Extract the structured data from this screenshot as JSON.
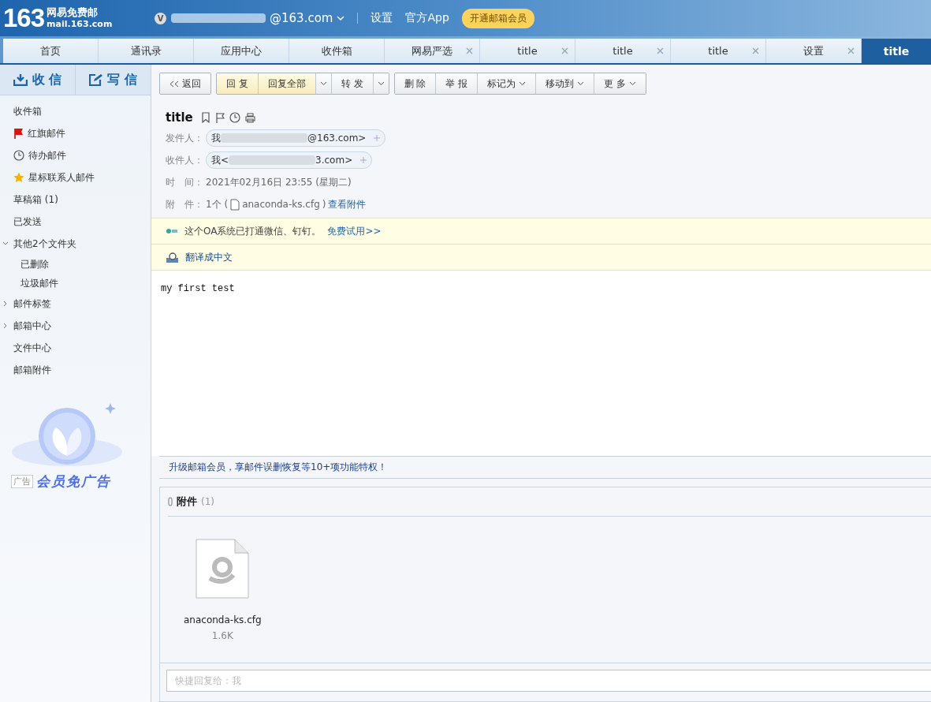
{
  "header": {
    "logo_number": "163",
    "logo_name": "网易免费邮",
    "logo_domain": "mail.163.com",
    "account_badge": "V",
    "account": "@163.com",
    "links": [
      "设置",
      "官方App"
    ],
    "vip_button": "开通邮箱会员"
  },
  "tabs": [
    {
      "label": "首页",
      "closable": false,
      "selected": false
    },
    {
      "label": "通讯录",
      "closable": false,
      "selected": false
    },
    {
      "label": "应用中心",
      "closable": false,
      "selected": false
    },
    {
      "label": "收件箱",
      "closable": false,
      "selected": false
    },
    {
      "label": "网易严选",
      "closable": true,
      "selected": false
    },
    {
      "label": "title",
      "closable": true,
      "selected": false
    },
    {
      "label": "title",
      "closable": true,
      "selected": false
    },
    {
      "label": "title",
      "closable": true,
      "selected": false
    },
    {
      "label": "设置",
      "closable": true,
      "selected": false
    },
    {
      "label": "title",
      "closable": false,
      "selected": true
    }
  ],
  "sidebar": {
    "receive": "收 信",
    "compose": "写 信",
    "items": [
      {
        "label": "收件箱",
        "kind": "plain"
      },
      {
        "label": "红旗邮件",
        "kind": "flag"
      },
      {
        "label": "待办邮件",
        "kind": "clock"
      },
      {
        "label": "星标联系人邮件",
        "kind": "star"
      },
      {
        "label": "草稿箱 (1)",
        "kind": "plain"
      },
      {
        "label": "已发送",
        "kind": "plain"
      },
      {
        "label": "其他2个文件夹",
        "kind": "folder",
        "expanded": true,
        "children": [
          {
            "label": "已删除"
          },
          {
            "label": "垃圾邮件"
          }
        ]
      },
      {
        "label": "邮件标签",
        "kind": "folder",
        "expanded": false
      },
      {
        "label": "邮箱中心",
        "kind": "folder",
        "expanded": false
      },
      {
        "label": "文件中心",
        "kind": "plain"
      },
      {
        "label": "邮箱附件",
        "kind": "plain"
      }
    ],
    "ad_tag": "广告",
    "ad_text": "会员免广告"
  },
  "toolbar": [
    [
      {
        "label": "返回",
        "kind": "back"
      }
    ],
    [
      {
        "label": "回 复",
        "kind": "reply"
      },
      {
        "label": "回复全部",
        "kind": "reply"
      },
      {
        "kind": "caret"
      },
      {
        "label": "转 发",
        "kind": "plain"
      },
      {
        "kind": "caret"
      }
    ],
    [
      {
        "label": "删 除",
        "kind": "plain"
      },
      {
        "label": "举 报",
        "kind": "plain"
      },
      {
        "label": "标记为",
        "kind": "menu"
      },
      {
        "label": "移动到",
        "kind": "menu"
      },
      {
        "label": "更 多",
        "kind": "menu"
      }
    ]
  ],
  "mail": {
    "title": "title",
    "from_label": "发件人：",
    "from_start": "我",
    "from_end": "@163.com>",
    "to_label": "收件人：",
    "to_start": "我<",
    "to_end": "3.com>",
    "time_label": "时　间：",
    "time": "2021年02月16日 23:55 (星期二)",
    "attach_label": "附　件：",
    "attach_count": "1个 (",
    "attach_file": "anaconda-ks.cfg",
    "attach_close": ")",
    "attach_link": "查看附件",
    "oa_text": "这个OA系统已打通微信、钉钉。",
    "oa_link": "免费试用>>",
    "translate": "翻译成中文",
    "body": "my first test",
    "upgrade": "升级邮箱会员，享邮件误删恢复等10+项功能特权！",
    "attachments_title": "附件",
    "attachments_count": "(1)",
    "attachments": [
      {
        "name": "anaconda-ks.cfg",
        "size": "1.6K"
      }
    ],
    "quick_reply": {
      "placeholder": "快捷回复给：我"
    }
  }
}
